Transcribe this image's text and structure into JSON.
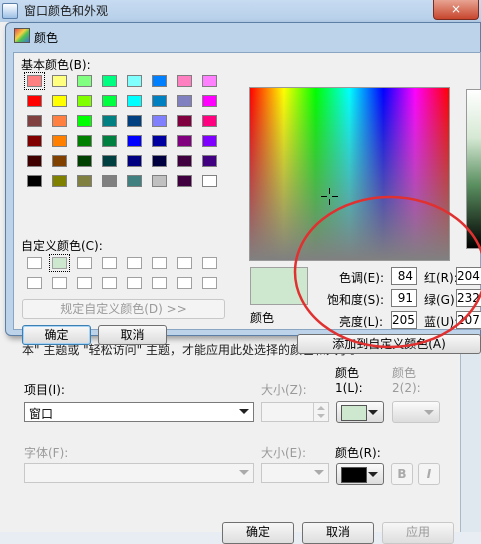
{
  "bgwindow": {
    "title": "窗口颜色和外观",
    "close_label": "×",
    "note": "本\" 主题或 \"轻松访问\" 主题，才能应用此处选择的颜色和大小。",
    "item_label": "项目(I):",
    "item_value": "窗口",
    "size_label": "大小(Z):",
    "color1_label": "颜色",
    "color1_sub": "1(L):",
    "color2_label": "颜色",
    "color2_sub": "2(2):",
    "font_label": "字体(F):",
    "font_size_label": "大小(E):",
    "font_color_label": "颜色(R):",
    "bold_label": "B",
    "italic_label": "I",
    "ok_label": "确定",
    "cancel_label": "取消",
    "apply_label": "应用",
    "color1_value": "#cde8cf",
    "font_color_value": "#000000"
  },
  "dialog": {
    "title": "颜色",
    "basic_colors_label": "基本颜色(B):",
    "custom_colors_label": "自定义颜色(C):",
    "define_custom_label": "规定自定义颜色(D) >>",
    "ok_label": "确定",
    "cancel_label": "取消",
    "color_solid_label": "颜色",
    "hue_label": "色调(E):",
    "hue_value": "84",
    "sat_label": "饱和度(S):",
    "sat_value": "91",
    "lum_label": "亮度(L):",
    "lum_value": "205",
    "red_label": "红(R):",
    "red_value": "204",
    "green_label": "绿(G):",
    "green_value": "232",
    "blue_label": "蓝(U):",
    "blue_value": "207",
    "add_custom_label": "添加到自定义颜色(A)",
    "preview_color": "#cde8cf",
    "basic_colors": [
      "#ff8080",
      "#ffff80",
      "#80ff80",
      "#00ff80",
      "#80ffff",
      "#0080ff",
      "#ff80c0",
      "#ff80ff",
      "#ff0000",
      "#ffff00",
      "#80ff00",
      "#00ff40",
      "#00ffff",
      "#0080c0",
      "#8080c0",
      "#ff00ff",
      "#804040",
      "#ff8040",
      "#00ff00",
      "#008080",
      "#004080",
      "#8080ff",
      "#800040",
      "#ff0080",
      "#800000",
      "#ff8000",
      "#008000",
      "#008040",
      "#0000ff",
      "#0000a0",
      "#800080",
      "#8000ff",
      "#400000",
      "#804000",
      "#004000",
      "#004040",
      "#000080",
      "#000040",
      "#400040",
      "#400080",
      "#000000",
      "#808000",
      "#808040",
      "#808080",
      "#408080",
      "#c0c0c0",
      "#400040",
      "#ffffff"
    ],
    "custom_colors": [
      "#ffffff",
      "#cde8cf",
      "#ffffff",
      "#ffffff",
      "#ffffff",
      "#ffffff",
      "#ffffff",
      "#ffffff",
      "#ffffff",
      "#ffffff",
      "#ffffff",
      "#ffffff",
      "#ffffff",
      "#ffffff",
      "#ffffff",
      "#ffffff"
    ],
    "annotation_color": "#e03030"
  }
}
